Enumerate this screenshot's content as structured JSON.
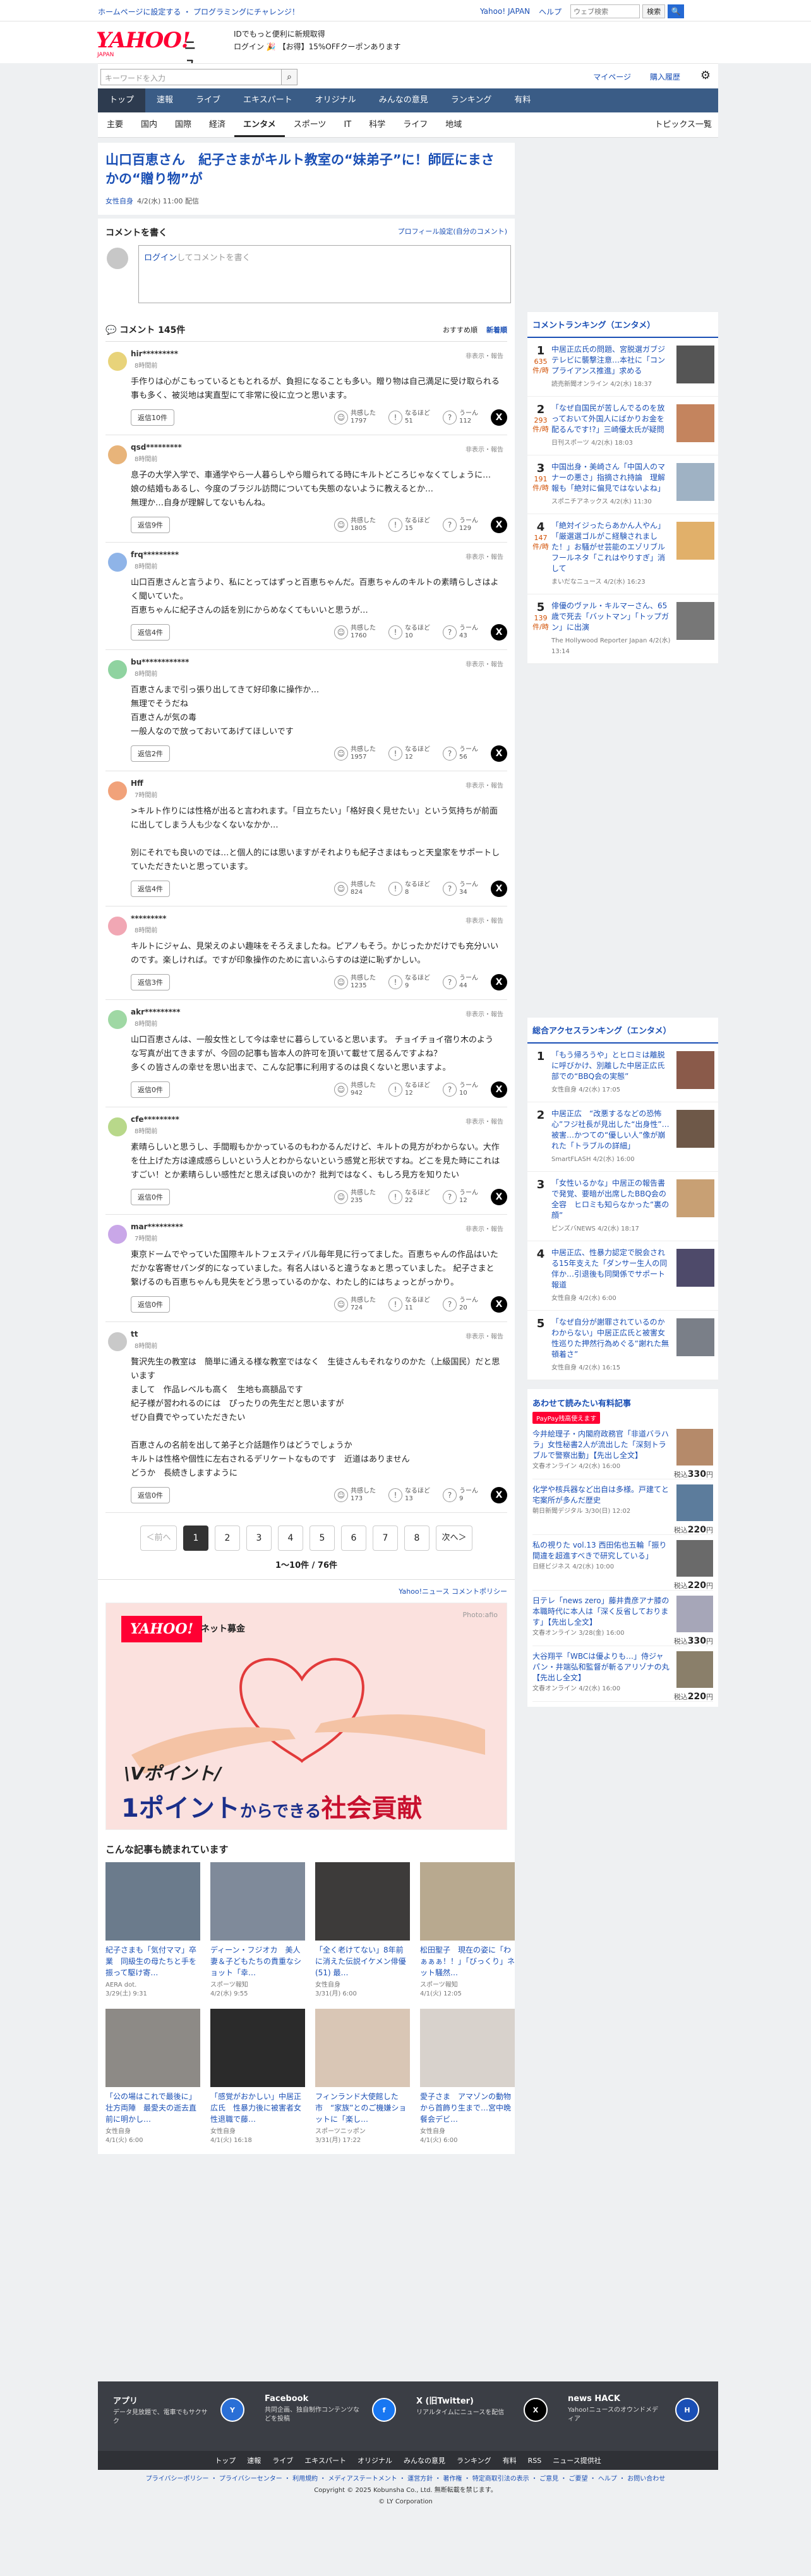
{
  "topstrip": {
    "left": "ホームページに設定する ・ プログラミングにチャレンジ！",
    "links": [
      "Yahoo! JAPAN",
      "ヘルプ"
    ],
    "search_placeholder": "ウェブ検索",
    "search_btn": "検索"
  },
  "header": {
    "logo": "YAHOO!",
    "logo_sub": "JAPAN",
    "news": "ニュース",
    "promo1": "IDでもっと便利に新規取得",
    "promo2": "ログイン 🎉 【お得】15%OFFクーポンあります"
  },
  "search": {
    "placeholder": "キーワードを入力",
    "links": [
      "マイページ",
      "購入履歴"
    ]
  },
  "nav1": [
    "トップ",
    "速報",
    "ライブ",
    "エキスパート",
    "オリジナル",
    "みんなの意見",
    "ランキング",
    "有料"
  ],
  "nav2": [
    "主要",
    "国内",
    "国際",
    "経済",
    "エンタメ",
    "スポーツ",
    "IT",
    "科学",
    "ライフ",
    "地域"
  ],
  "nav2_right": "トピックス一覧",
  "article": {
    "title": "山口百恵さん　紀子さまがキルト教室の“妹弟子”に！師匠にまさかの“贈り物”が",
    "source": "女性自身",
    "date": "4/2(水) 11:00 配信"
  },
  "comments_form": {
    "title": "コメントを書く",
    "settings": "プロフィール設定(自分のコメント)",
    "login": "ログイン",
    "placeholder": "してコメントを書く"
  },
  "comments_bar": {
    "title": "コメント 145件",
    "sort1": "おすすめ順",
    "sort2": "新着順"
  },
  "reaction_labels": {
    "a": "共感した",
    "b": "なるほど",
    "c": "うーん"
  },
  "report": "非表示・報告",
  "comments": [
    {
      "name": "hir*********",
      "time": "8時間前",
      "body": "手作りは心がこもっているともとれるが、負担になることも多い。贈り物は自己満足に受け取られる事も多く、被災地は実直型にて非常に役に立つと思います。",
      "replies": "返信10件",
      "a": "1797",
      "b": "51",
      "c": "112",
      "color": "#e8d37a"
    },
    {
      "name": "qsd*********",
      "time": "8時間前",
      "body": "息子の大学入学で、車通学やら一人暮らしやら贈られてる時にキルトどころじゃなくてしょうに…\n娘の結婚もあるし、今度のブラジル訪問についても失態のないように教えるとか…\n無理か…自身が理解してないもんね。",
      "replies": "返信9件",
      "a": "1805",
      "b": "15",
      "c": "129",
      "color": "#e8b47a"
    },
    {
      "name": "frq*********",
      "time": "8時間前",
      "body": "山口百恵さんと言うより、私にとってはずっと百恵ちゃんだ。百恵ちゃんのキルトの素晴らしさはよく聞いていた。\n百恵ちゃんに紀子さんの話を別にからめなくてもいいと思うが…",
      "replies": "返信4件",
      "a": "1760",
      "b": "10",
      "c": "43",
      "color": "#8fb4e8"
    },
    {
      "name": "bu************",
      "time": "8時間前",
      "body": "百恵さんまで引っ張り出してきて好印象に操作か…\n無理でそうだね\n百恵さんが気の毒\n一般人なので放っておいてあげてほしいです",
      "replies": "返信2件",
      "a": "1957",
      "b": "12",
      "c": "56",
      "color": "#8fd3a0"
    },
    {
      "name": "Hff",
      "time": "7時間前",
      "body": ">キルト作りには性格が出ると言われます。「目立ちたい」「格好良く見せたい」という気持ちが前面に出してしまう人も少なくないなかか…\n\n別にそれでも良いのでは…と個人的には思いますがそれよりも紀子さまはもっと天皇家をサポートしていただきたいと思っています。",
      "replies": "返信4件",
      "a": "824",
      "b": "8",
      "c": "34",
      "color": "#f1a27a"
    },
    {
      "name": "*********",
      "time": "8時間前",
      "body": "キルトにジャム、見栄えのよい趣味をそろえましたね。ピアノもそう。かじったかだけでも充分いいのです。楽しければ。ですが印象操作のために言いふらすのは逆に恥ずかしい。",
      "replies": "返信3件",
      "a": "1235",
      "b": "9",
      "c": "44",
      "color": "#f1a7b4"
    },
    {
      "name": "akr*********",
      "time": "8時間前",
      "body": "山口百恵さんは、一般女性として今は幸せに暮らしていると思います。 チョイチョイ宿り木のような写真が出てきますが、今回の記事も皆本人の許可を頂いて載せて居るんですよね？\n多くの皆さんの幸せを思い出まで、こんな記事に利用するのは良くないと思いますよ。",
      "replies": "返信0件",
      "a": "942",
      "b": "12",
      "c": "10",
      "color": "#9fd8a4"
    },
    {
      "name": "cfe*********",
      "time": "8時間前",
      "body": "素晴らしいと思うし、手間暇もかかっているのもわかるんだけど、キルトの見方がわからない。大作を仕上げた方は達成感らしいという人とわからないという感覚と形状ですね。どこを見た時にこれはすごい！とか素晴らしい感性だと思えば良いのか？批判ではなく、もしろ見方を知りたい",
      "replies": "返信0件",
      "a": "235",
      "b": "22",
      "c": "12",
      "color": "#b8d88a"
    },
    {
      "name": "mar*********",
      "time": "7時間前",
      "body": "東京ドームでやっていた国際キルトフェスティバル毎年見に行ってました。百恵ちゃんの作品はいただかな客寄せパンダ的になっていました。有名人はいると違うなぁと思っていました。 紀子さまと繋げるのも百恵ちゃんも見失をどう思っているのかな、わたし的にはちょっとがっかり。",
      "replies": "返信0件",
      "a": "724",
      "b": "11",
      "c": "20",
      "color": "#c9a7e8"
    },
    {
      "name": "tt",
      "time": "8時間前",
      "body": "贅沢先生の教室は　簡単に通える様な教室ではなく　生徒さんもそれなりのかた（上級国民）だと思います\nまして　作品レベルも高く　生地も高額品です\n紀子様が習われるのには　ぴったりの先生だと思いますが\nぜひ自費でやっていただきたい\n\n百恵さんの名前を出して弟子と介話題作りはどうでしょうか\nキルトは性格や個性に左右されるデリケートなものです　近道はありません\nどうか　長続きしますように",
      "replies": "返信0件",
      "a": "173",
      "b": "13",
      "c": "9",
      "color": "#c9c9c9"
    }
  ],
  "pager": {
    "prev": "＜前へ",
    "pages": [
      "1",
      "2",
      "3",
      "4",
      "5",
      "6",
      "7",
      "8"
    ],
    "next": "次へ＞",
    "count": "1〜10件 / 76件"
  },
  "policy": "Yahoo!ニュース コメントポリシー",
  "ad": {
    "logo": "YAHOO!",
    "logo_sub": "JAPAN",
    "label": "ネット募金",
    "photo": "Photo:afio",
    "vpoint": "\\Vポイント/",
    "big1": "1ポイント",
    "big2": "からできる",
    "big3": "社会貢献"
  },
  "reads": {
    "title": "こんな記事も読まれています",
    "items": [
      {
        "t": "紀子さまも「気付ママ」卒業　同級生の母たちと手を振って駆け寄…",
        "s": "AERA dot.",
        "d": "3/29(土) 9:31",
        "c": "#6b7b8c"
      },
      {
        "t": "ディーン・フジオカ　美人妻＆子どもたちの貴重なショット「幸…",
        "s": "スポーツ報知",
        "d": "4/2(水) 9:55",
        "c": "#7f8a9a"
      },
      {
        "t": "「全く老けてない」8年前に消えた伝説イケメン俳優(51) 最…",
        "s": "女性自身",
        "d": "3/31(月) 6:00",
        "c": "#3d3b3a"
      },
      {
        "t": "松田聖子　現在の姿に「わぁぁぁ！！」「びっくり」ネット騒然…",
        "s": "スポーツ報知",
        "d": "4/1(火) 12:05",
        "c": "#b8a98f"
      },
      {
        "t": "「公の場はこれで最後に」壮方両陣　最愛夫の逝去直前に明かし…",
        "s": "女性自身",
        "d": "4/1(火) 6:00",
        "c": "#8d8a86"
      },
      {
        "t": "「感覚がおかしい」中居正広氏　性暴力後に被害者女性退職で藤…",
        "s": "女性自身",
        "d": "4/1(火) 16:18",
        "c": "#2b2b2b"
      },
      {
        "t": "フィンランド大使館した市　“家族”とのご機嫌ショットに「楽し…",
        "s": "スポーツニッポン",
        "d": "3/31(月) 17:22",
        "c": "#d9c6b5"
      },
      {
        "t": "愛子さま　アマゾンの動物から首飾り生まで…宮中晩餐会デビ…",
        "s": "女性自身",
        "d": "4/1(火) 6:00",
        "c": "#d8d2cc"
      }
    ]
  },
  "ranking": {
    "title": "コメントランキング（エンタメ）",
    "unit": "件/時",
    "items": [
      {
        "no": "1",
        "cnt": "635",
        "t": "中居正広氏の問題、宮脱選ガブジテレビに襲撃注意…本社に「コンプライアンス推進」求める",
        "s": "読売新聞オンライン",
        "d": "4/2(水) 18:37",
        "c": "#555"
      },
      {
        "no": "2",
        "cnt": "293",
        "t": "「なぜ自国民が苦しんでるのを放っておいて外国人にばかりお金を配るんです!?」三崎優太氏が疑問",
        "s": "日刊スポーツ",
        "d": "4/2(水) 18:03",
        "c": "#c4845e"
      },
      {
        "no": "3",
        "cnt": "191",
        "t": "中国出身・美崎さん「中国人のマナーの悪さ」指摘され持論　理解報も「絶対に偏見ではないよね」",
        "s": "スポニチアネックス",
        "d": "4/2(水) 11:30",
        "c": "#9fb2c4"
      },
      {
        "no": "4",
        "cnt": "147",
        "t": "「絶対イジったらあかん人やん」「厳選選ゴルがこ経験されました！」お騒がせ芸能のエゾリブルフールネタ「これはやりすぎ」消して",
        "s": "まいだなニュース",
        "d": "4/2(水) 16:23",
        "c": "#e1b06a"
      },
      {
        "no": "5",
        "cnt": "139",
        "t": "俳優のヴァル・キルマーさん、65歳で死去「バットマン」「トップガン」に出演",
        "s": "The Hollywood Reporter Japan",
        "d": "4/2(水) 13:14",
        "c": "#777"
      }
    ]
  },
  "access": {
    "title": "総合アクセスランキング（エンタメ）",
    "items": [
      {
        "no": "1",
        "t": "「もう帰ろうや」とヒロミは離脱に呼びかけ、別離した中居正広氏部での“BBQ会の実態”",
        "s": "女性自身",
        "d": "4/2(水) 17:05",
        "c": "#8a5a4a"
      },
      {
        "no": "2",
        "t": "中居正広　“改悪するなどの恐怖心”フジ社長が見出した“出身性”…被害…かつての“優しい人”像が崩れた「トラブルの詳細」",
        "s": "SmartFLASH",
        "d": "4/2(水) 16:00",
        "c": "#6e5848"
      },
      {
        "no": "3",
        "t": "「女性いるかな」中居正の報告書で発覚、要暗が出席したBBQ会の全容　ヒロミも知らなかった“裏の顔”",
        "s": "ピンズバNEWS",
        "d": "4/2(水) 18:17",
        "c": "#c8a074"
      },
      {
        "no": "4",
        "t": "中居正広、性暴力認定で脱会される15年支えた「ダンサー生人の同伴か…引退後も同関係でサポート報道",
        "s": "女性自身",
        "d": "4/2(水) 6:00",
        "c": "#4e4a6a"
      },
      {
        "no": "5",
        "t": "「なぜ自分が謝罪されているのかわからない」中居正広氏と被害女性巡りた押然行為めぐる“謝れた無頓着さ”",
        "s": "女性自身",
        "d": "4/2(水) 16:15",
        "c": "#7a7f88"
      }
    ]
  },
  "paid": {
    "title": "あわせて読みたい有料記事",
    "badge": "PayPay残高使えます",
    "items": [
      {
        "t": "今井絵理子・内閣府政務官「非道バラハラ」女性秘書2人が流出した「深刻トラブルで警察出動」【先出し全文】",
        "s": "文春オンライン",
        "d": "4/2(水) 16:00",
        "p": "330",
        "c": "#b58a6a"
      },
      {
        "t": "化学や核兵器など出自は多様。戸建てと宅案所が多んだ歴史",
        "s": "朝日新聞デジタル",
        "d": "3/30(日) 12:02",
        "p": "220",
        "c": "#5c7c9c"
      },
      {
        "t": "私の視りた vol.13 西田佑也五輪「振り間違を超進すべきで研究している」",
        "s": "日経ビジネス",
        "d": "4/2(水) 10:00",
        "p": "220",
        "c": "#6a6a6a"
      },
      {
        "t": "日テレ「news zero」藤井貴彦アナ膝の 本職時代に本人は「深く反省しております」【先出し全文】",
        "s": "文春オンライン",
        "d": "3/28(金) 16:00",
        "p": "330",
        "c": "#a6a6b8"
      },
      {
        "t": "大谷翔平「WBCは優よりも…」侍ジャパン・井端弘和監督が斬るアリゾナの丸【先出し全文】",
        "s": "文春オンライン",
        "d": "4/2(水) 16:00",
        "p": "220",
        "c": "#8a7f6a"
      }
    ]
  },
  "footer": {
    "cols": [
      {
        "t": "アプリ",
        "d": "データ見放題で、電車でもサクサク",
        "ic": "Y"
      },
      {
        "t": "Facebook",
        "d": "共同企画、独自制作コンテンツなどを投稿",
        "ic": "f"
      },
      {
        "t": "X (旧Twitter)",
        "d": "リアルタイムにニュースを配信",
        "ic": "X"
      },
      {
        "t": "news HACK",
        "d": "Yahoo!ニュースのオウンドメディア",
        "ic": "H"
      }
    ],
    "nav": [
      "トップ",
      "速報",
      "ライブ",
      "エキスパート",
      "オリジナル",
      "みんなの意見",
      "ランキング",
      "有料",
      "RSS",
      "ニュース提供社"
    ],
    "links": "プライバシーポリシー ・ プライバシーセンター ・ 利用規約 ・ メディアステートメント ・ 運営方針 ・ 著作権 ・ 特定商取引法の表示 ・ ご意見 ・ ご要望 ・ ヘルプ ・ お問い合わせ",
    "copy1": "Copyright © 2025 Kobunsha Co., Ltd. 無断転載を禁じます。",
    "copy2": "© LY Corporation"
  }
}
